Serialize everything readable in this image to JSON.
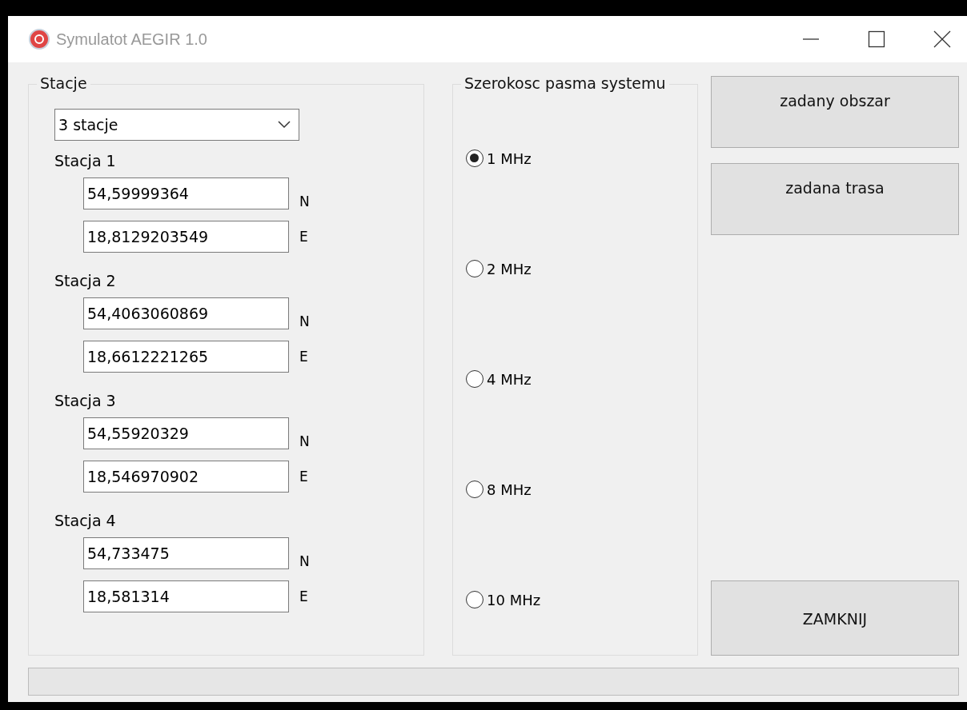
{
  "window": {
    "title": "Symulatot AEGIR 1.0"
  },
  "stations": {
    "title": "Stacje",
    "count_select": {
      "value": "3 stacje"
    },
    "items": [
      {
        "label": "Stacja 1",
        "lat": "54,59999364",
        "lat_unit": "N",
        "lon": "18,8129203549",
        "lon_unit": "E"
      },
      {
        "label": "Stacja 2",
        "lat": "54,4063060869",
        "lat_unit": "N",
        "lon": "18,6612221265",
        "lon_unit": "E"
      },
      {
        "label": "Stacja 3",
        "lat": "54,55920329",
        "lat_unit": "N",
        "lon": "18,546970902",
        "lon_unit": "E"
      },
      {
        "label": "Stacja 4",
        "lat": "54,733475",
        "lat_unit": "N",
        "lon": "18,581314",
        "lon_unit": "E"
      }
    ]
  },
  "bandwidth": {
    "title": "Szerokosc pasma systemu",
    "options": [
      {
        "label": "1 MHz",
        "selected": true
      },
      {
        "label": "2 MHz",
        "selected": false
      },
      {
        "label": "4 MHz",
        "selected": false
      },
      {
        "label": "8 MHz",
        "selected": false
      },
      {
        "label": "10 MHz",
        "selected": false
      }
    ]
  },
  "buttons": {
    "top": [
      "zadany obszar",
      "zadana trasa"
    ],
    "bottom": [
      "ZAMKNIJ"
    ]
  },
  "progress": {
    "level": 0
  }
}
